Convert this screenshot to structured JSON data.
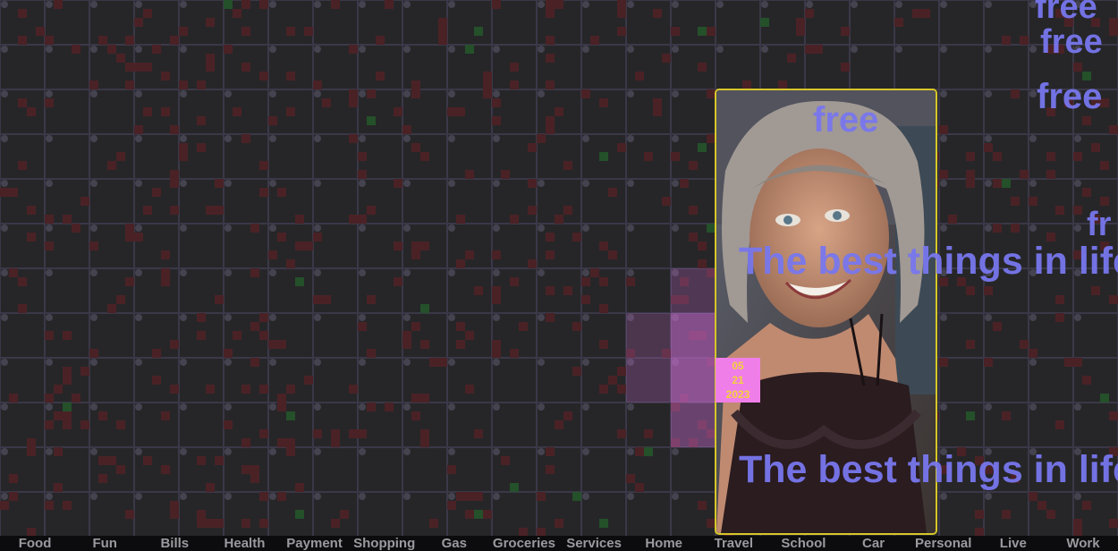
{
  "colors": {
    "background": "#262628",
    "grid_line": "#3a3848",
    "grid_node": "#45434f",
    "cell_red": "#4a2226",
    "cell_green": "#24502a",
    "heat_pink": "#d070d8",
    "frame_border": "#d7c628",
    "overlay_text": "#7877ee",
    "badge_bg": "#f07ee8",
    "badge_text": "#f3d23a"
  },
  "board": {
    "photo_label": "portrait-photo",
    "date_badge": {
      "month": "05",
      "day": "21",
      "year": "2023"
    },
    "overlay_texts": [
      "free",
      "free",
      "free",
      "free",
      "fr",
      "The best things in life",
      "The best things in life"
    ]
  },
  "categories": [
    "Food",
    "Fun",
    "Bills",
    "Health",
    "Payment",
    "Shopping",
    "Gas",
    "Groceries",
    "Services",
    "Home",
    "Travel",
    "School",
    "Car",
    "Personal",
    "Live",
    "Work"
  ]
}
